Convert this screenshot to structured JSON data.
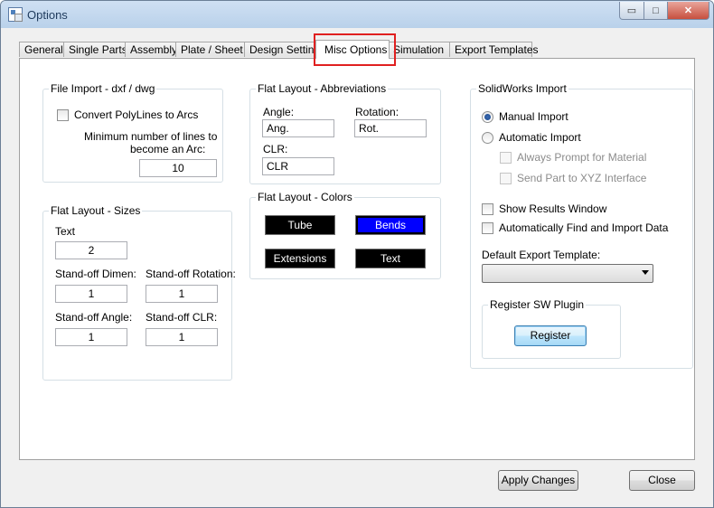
{
  "window": {
    "title": "Options",
    "controls": {
      "minimize": "▭",
      "maximize": "□",
      "close": "✕"
    }
  },
  "tabs": [
    "General",
    "Single Parts",
    "Assembly",
    "Plate / Sheet",
    "Design Settings",
    "Misc Options",
    "Simulation",
    "Export Templates"
  ],
  "active_tab": "Misc Options",
  "file_import": {
    "title": "File Import - dxf / dwg",
    "convert_polylines_label": "Convert PolyLines to Arcs",
    "min_lines_label_1": "Minimum number of lines to",
    "min_lines_label_2": "become an Arc:",
    "min_lines_value": "10"
  },
  "abbreviations": {
    "title": "Flat Layout - Abbreviations",
    "angle_label": "Angle:",
    "angle_value": "Ang.",
    "rotation_label": "Rotation:",
    "rotation_value": "Rot.",
    "clr_label": "CLR:",
    "clr_value": "CLR"
  },
  "sizes": {
    "title": "Flat Layout - Sizes",
    "text_label": "Text",
    "text_value": "2",
    "standoff_dimen_label": "Stand-off Dimen:",
    "standoff_dimen_value": "1",
    "standoff_rotation_label": "Stand-off Rotation:",
    "standoff_rotation_value": "1",
    "standoff_angle_label": "Stand-off  Angle:",
    "standoff_angle_value": "1",
    "standoff_clr_label": "Stand-off  CLR:",
    "standoff_clr_value": "1"
  },
  "colors": {
    "title": "Flat Layout - Colors",
    "tube_label": "Tube",
    "tube_color": "#000000",
    "bends_label": "Bends",
    "bends_color": "#0000ff",
    "extensions_label": "Extensions",
    "extensions_color": "#000000",
    "text_label": "Text",
    "text_color": "#000000"
  },
  "solidworks": {
    "title": "SolidWorks Import",
    "manual_import_label": "Manual Import",
    "automatic_import_label": "Automatic Import",
    "always_prompt_label": "Always Prompt for Material",
    "send_part_label": "Send Part to XYZ Interface",
    "show_results_label": "Show Results Window",
    "auto_find_label": "Automatically Find and Import Data",
    "default_export_label": "Default Export Template:",
    "default_export_value": "",
    "register_group_title": "Register SW Plugin",
    "register_button": "Register"
  },
  "footer": {
    "apply_button": "Apply Changes",
    "close_button": "Close"
  },
  "accent": {
    "highlight_color": "#e02020"
  }
}
